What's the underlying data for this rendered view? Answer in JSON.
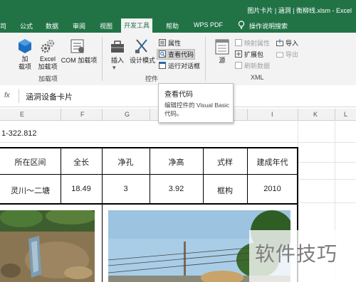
{
  "window": {
    "title": "图片卡片 | 涵洞 | 衡柳线.xlsm - Excel"
  },
  "tabs": [
    "司",
    "公式",
    "数据",
    "审阅",
    "视图",
    "开发工具",
    "帮助",
    "WPS PDF",
    "操作说明搜索"
  ],
  "active_tab": "开发工具",
  "ribbon": {
    "addins": {
      "label": "加载项",
      "addins_btn": "加\n载项",
      "excel_addins": "Excel\n加载项",
      "com_addins": "COM 加载项"
    },
    "controls": {
      "label": "控件",
      "insert": "插入",
      "design_mode": "设计模式",
      "properties": "属性",
      "view_code": "查看代码",
      "run_dialog": "运行对话框"
    },
    "xml": {
      "label": "XML",
      "source": "源",
      "map_properties": "映射属性",
      "expansion_packs": "扩展包",
      "refresh_data": "刷新数据",
      "import": "导入",
      "export": "导出"
    }
  },
  "formula_bar": {
    "fx": "fx",
    "value": "涵洞设备卡片"
  },
  "columns": [
    "E",
    "F",
    "G",
    "H",
    "I",
    "K",
    "L"
  ],
  "sheet": {
    "coord_text": "1-322.812",
    "headers": [
      "所在区间",
      "全长",
      "净孔",
      "净高",
      "式样",
      "建成年代"
    ],
    "row": [
      "灵川～二塘",
      "18.49",
      "3",
      "3.92",
      "框构",
      "2010"
    ]
  },
  "tooltip": {
    "title": "查看代码",
    "desc": "编辑控件的 Visual Basic 代码。"
  },
  "watermark": "软件技巧",
  "colors": {
    "excel_green": "#217346",
    "ribbon_bg": "#f3f3f3"
  }
}
